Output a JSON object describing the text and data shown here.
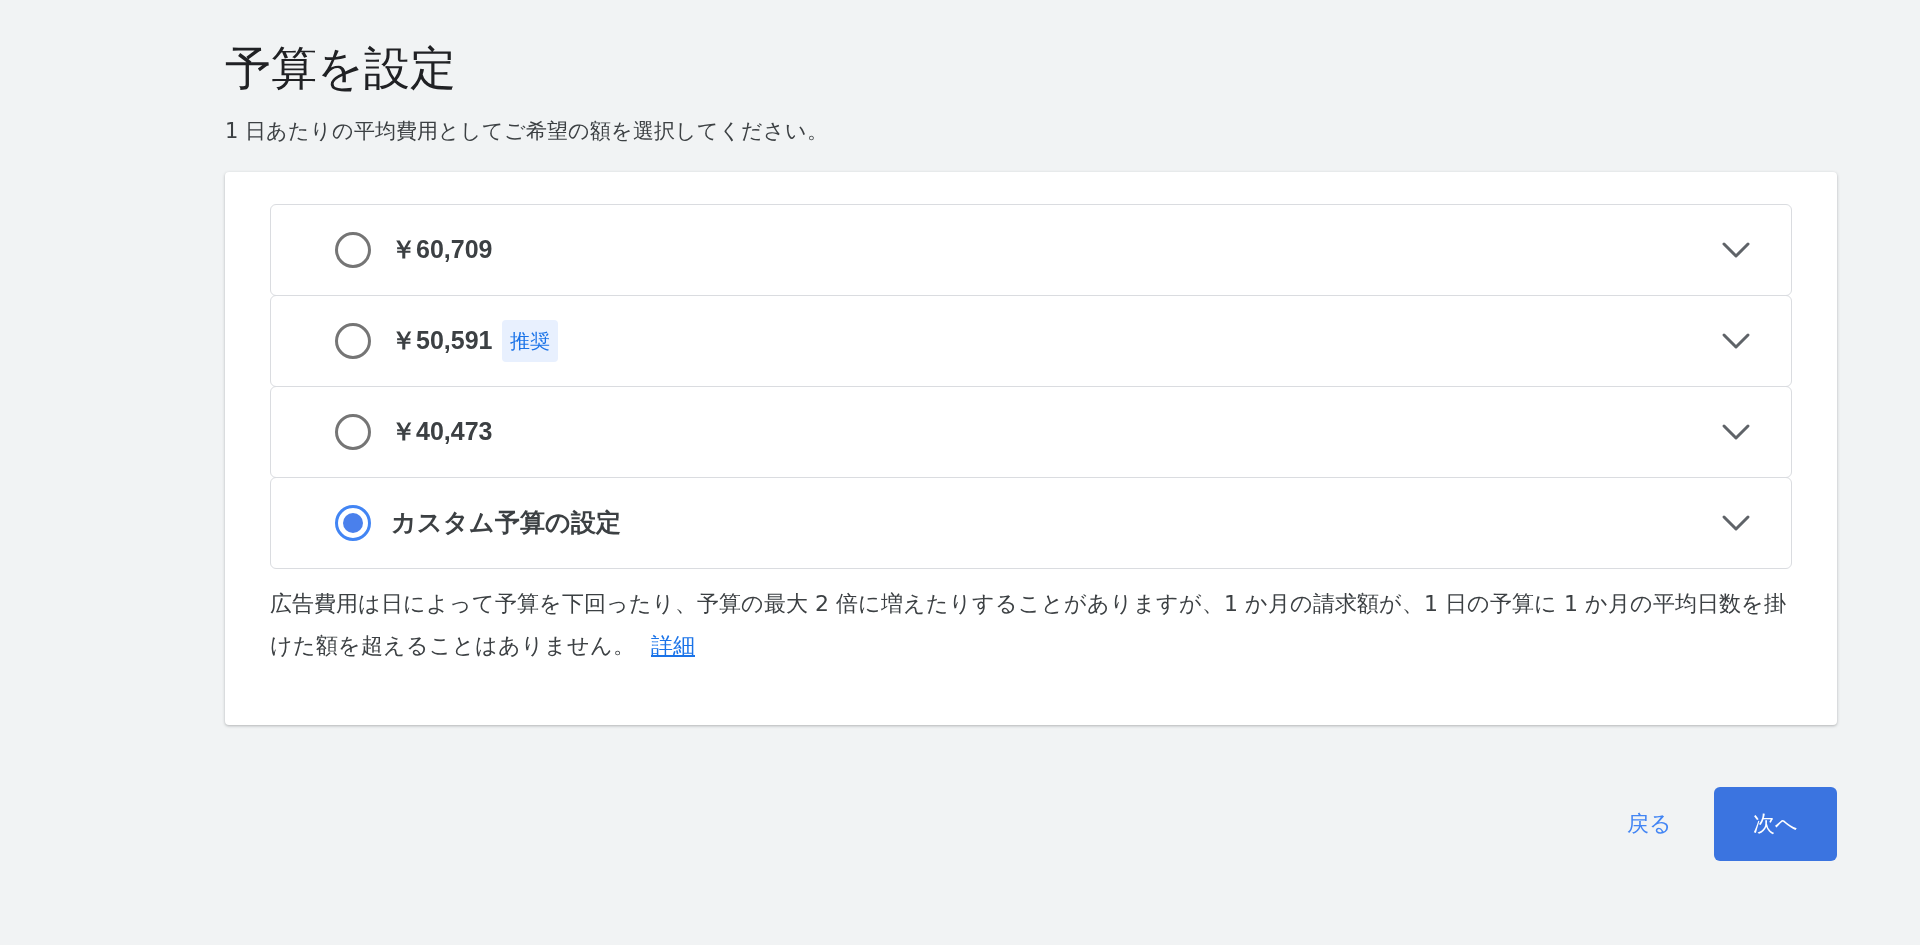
{
  "title": "予算を設定",
  "subtitle": "1 日あたりの平均費用としてご希望の額を選択してください。",
  "options": [
    {
      "label": "￥60,709",
      "selected": false
    },
    {
      "label": "￥50,591",
      "badge": "推奨",
      "selected": false
    },
    {
      "label": "￥40,473",
      "selected": false
    },
    {
      "label": "カスタム予算の設定",
      "selected": true
    }
  ],
  "note": {
    "text": "広告費用は日によって予算を下回ったり、予算の最大 2 倍に増えたりすることがありますが、1 か月の請求額が、1 日の予算に 1 か月の平均日数を掛けた額を超えることはありません。",
    "link": "詳細"
  },
  "buttons": {
    "back": "戻る",
    "next": "次へ"
  }
}
